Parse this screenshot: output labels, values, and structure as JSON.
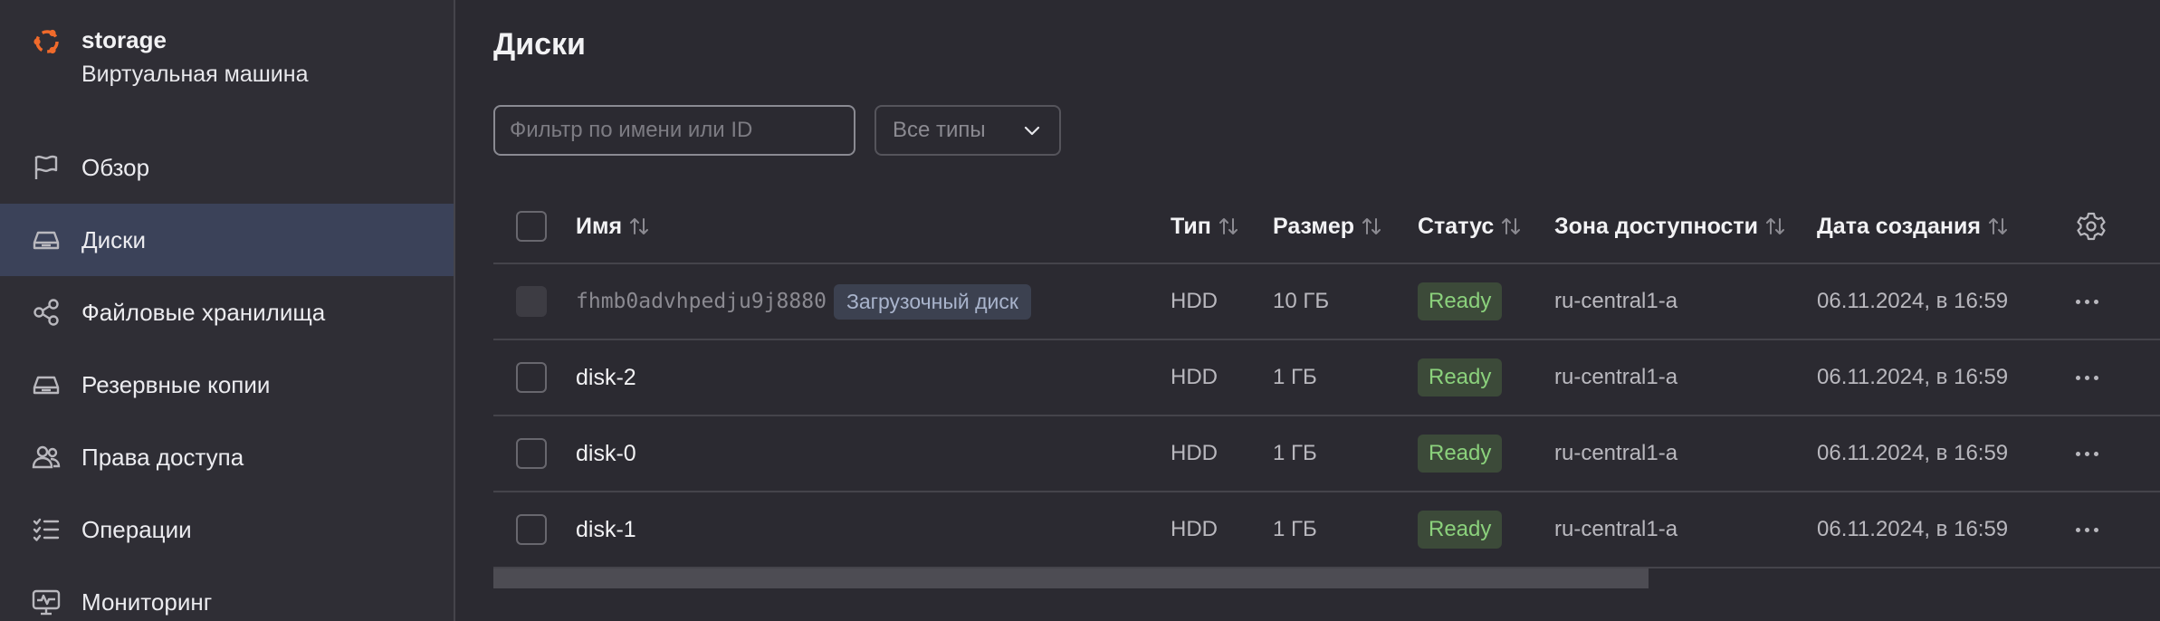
{
  "brand": {
    "title": "storage",
    "subtitle": "Виртуальная машина"
  },
  "sidebar": {
    "items": [
      {
        "label": "Обзор",
        "icon": "flag-icon",
        "active": false
      },
      {
        "label": "Диски",
        "icon": "disk-icon",
        "active": true
      },
      {
        "label": "Файловые хранилища",
        "icon": "share-icon",
        "active": false
      },
      {
        "label": "Резервные копии",
        "icon": "backup-icon",
        "active": false
      },
      {
        "label": "Права доступа",
        "icon": "people-icon",
        "active": false
      },
      {
        "label": "Операции",
        "icon": "checklist-icon",
        "active": false
      },
      {
        "label": "Мониторинг",
        "icon": "monitor-icon",
        "active": false
      }
    ]
  },
  "main": {
    "title": "Диски",
    "filter": {
      "placeholder": "Фильтр по имени или ID",
      "value": ""
    },
    "type_select": {
      "label": "Все типы"
    }
  },
  "table": {
    "columns": {
      "name": "Имя",
      "type": "Тип",
      "size": "Размер",
      "status": "Статус",
      "zone": "Зона доступности",
      "date": "Дата создания"
    },
    "rows": [
      {
        "name": "fhmb0advhpedju9j8880",
        "badge": "Загрузочный диск",
        "type": "HDD",
        "size": "10 ГБ",
        "status": "Ready",
        "zone": "ru-central1-a",
        "date": "06.11.2024, в 16:59"
      },
      {
        "name": "disk-2",
        "type": "HDD",
        "size": "1 ГБ",
        "status": "Ready",
        "zone": "ru-central1-a",
        "date": "06.11.2024, в 16:59"
      },
      {
        "name": "disk-0",
        "type": "HDD",
        "size": "1 ГБ",
        "status": "Ready",
        "zone": "ru-central1-a",
        "date": "06.11.2024, в 16:59"
      },
      {
        "name": "disk-1",
        "type": "HDD",
        "size": "1 ГБ",
        "status": "Ready",
        "zone": "ru-central1-a",
        "date": "06.11.2024, в 16:59"
      }
    ]
  },
  "colors": {
    "brand": "#f06a2b",
    "active_nav": "#3b4259",
    "ready_text": "#8bd17c",
    "ready_bg": "#3c4a39"
  }
}
